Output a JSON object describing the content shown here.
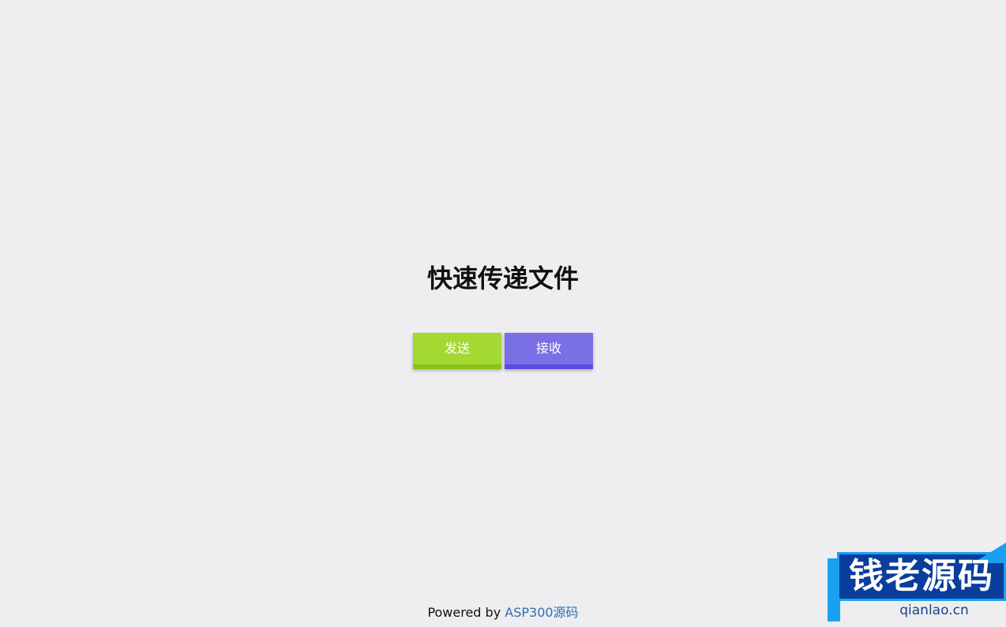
{
  "main": {
    "title": "快速传递文件",
    "send_label": "发送",
    "receive_label": "接收"
  },
  "footer": {
    "prefix": "Powered by ",
    "link_text": "ASP300源码"
  },
  "watermark": {
    "text": "钱老源码",
    "subtext": "qianlao.cn"
  },
  "colors": {
    "background": "#eeeef0",
    "send_button": "#a4d833",
    "receive_button": "#7b6fe6",
    "footer_link": "#2e6fae"
  }
}
